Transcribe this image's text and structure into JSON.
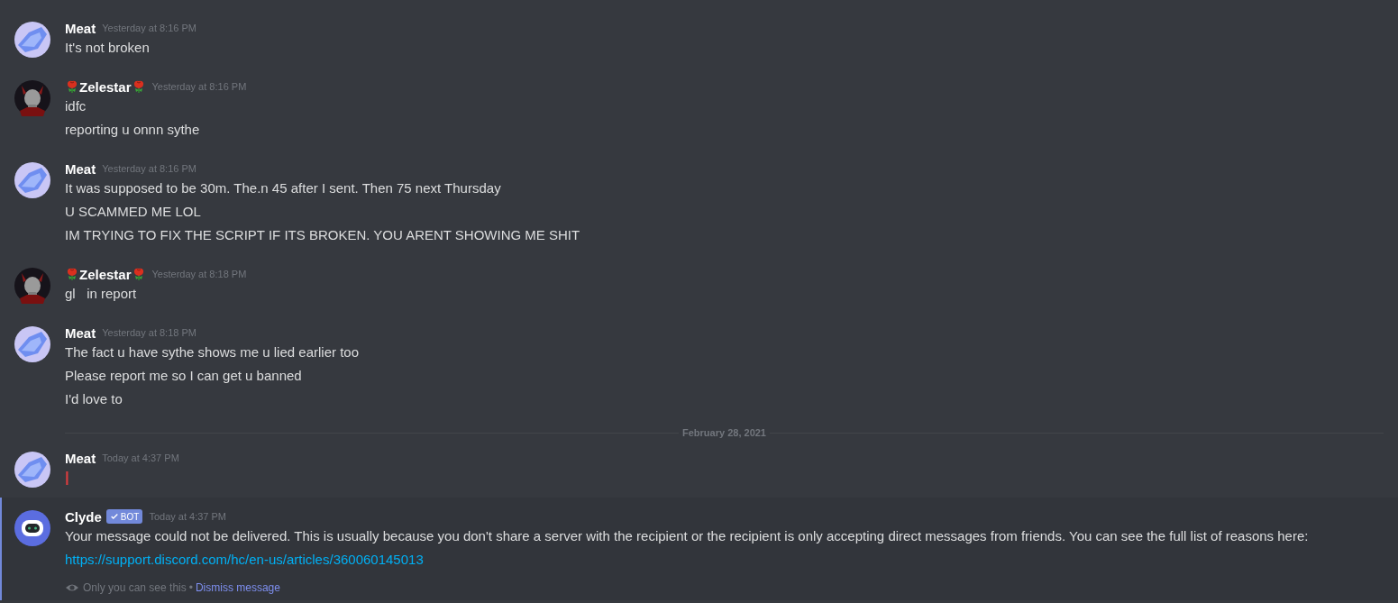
{
  "messages": [
    {
      "author": "Meat",
      "roses": false,
      "timestamp": "Yesterday at 8:16 PM",
      "lines": [
        {
          "kind": "text",
          "text": "It's not broken"
        }
      ]
    },
    {
      "author": "Zelestar",
      "roses": true,
      "timestamp": "Yesterday at 8:16 PM",
      "lines": [
        {
          "kind": "text",
          "text": "idfc"
        },
        {
          "kind": "text",
          "text": "reporting u onnn sythe"
        }
      ]
    },
    {
      "author": "Meat",
      "roses": false,
      "timestamp": "Yesterday at 8:16 PM",
      "lines": [
        {
          "kind": "text",
          "text": "It was supposed to be 30m. The.n 45 after I sent. Then 75 next Thursday"
        },
        {
          "kind": "text",
          "text": "U SCAMMED ME LOL"
        },
        {
          "kind": "text",
          "text": "IM TRYING TO FIX THE SCRIPT IF ITS BROKEN. YOU ARENT SHOWING ME SHIT"
        }
      ]
    },
    {
      "author": "Zelestar",
      "roses": true,
      "timestamp": "Yesterday at 8:18 PM",
      "lines": [
        {
          "kind": "text",
          "text": "gl   in report"
        }
      ]
    },
    {
      "author": "Meat",
      "roses": false,
      "timestamp": "Yesterday at 8:18 PM",
      "lines": [
        {
          "kind": "text",
          "text": "The fact u have sythe shows me u lied earlier too"
        },
        {
          "kind": "text",
          "text": "Please report me so I can get u banned"
        },
        {
          "kind": "text",
          "text": "I'd love to"
        }
      ]
    },
    {
      "kind": "divider",
      "date": "February 28, 2021"
    },
    {
      "author": "Meat",
      "roses": false,
      "timestamp": "Today at 4:37 PM",
      "lines": [
        {
          "kind": "text",
          "text": "|",
          "color": "#d83c3e"
        }
      ]
    },
    {
      "author": "Clyde",
      "roses": false,
      "badge": "BOT",
      "ephemeral": true,
      "timestamp": "Today at 4:37 PM",
      "lines": [
        {
          "kind": "text",
          "text": "Your message could not be delivered. This is usually because you don't share a server with the recipient or the recipient is only accepting direct messages from friends. You can see the full list of reasons here:"
        },
        {
          "kind": "link",
          "text": "https://support.discord.com/hc/en-us/articles/360060145013"
        }
      ],
      "note": "Only you can see this",
      "note_separator": "•",
      "dismiss": "Dismiss message"
    }
  ]
}
